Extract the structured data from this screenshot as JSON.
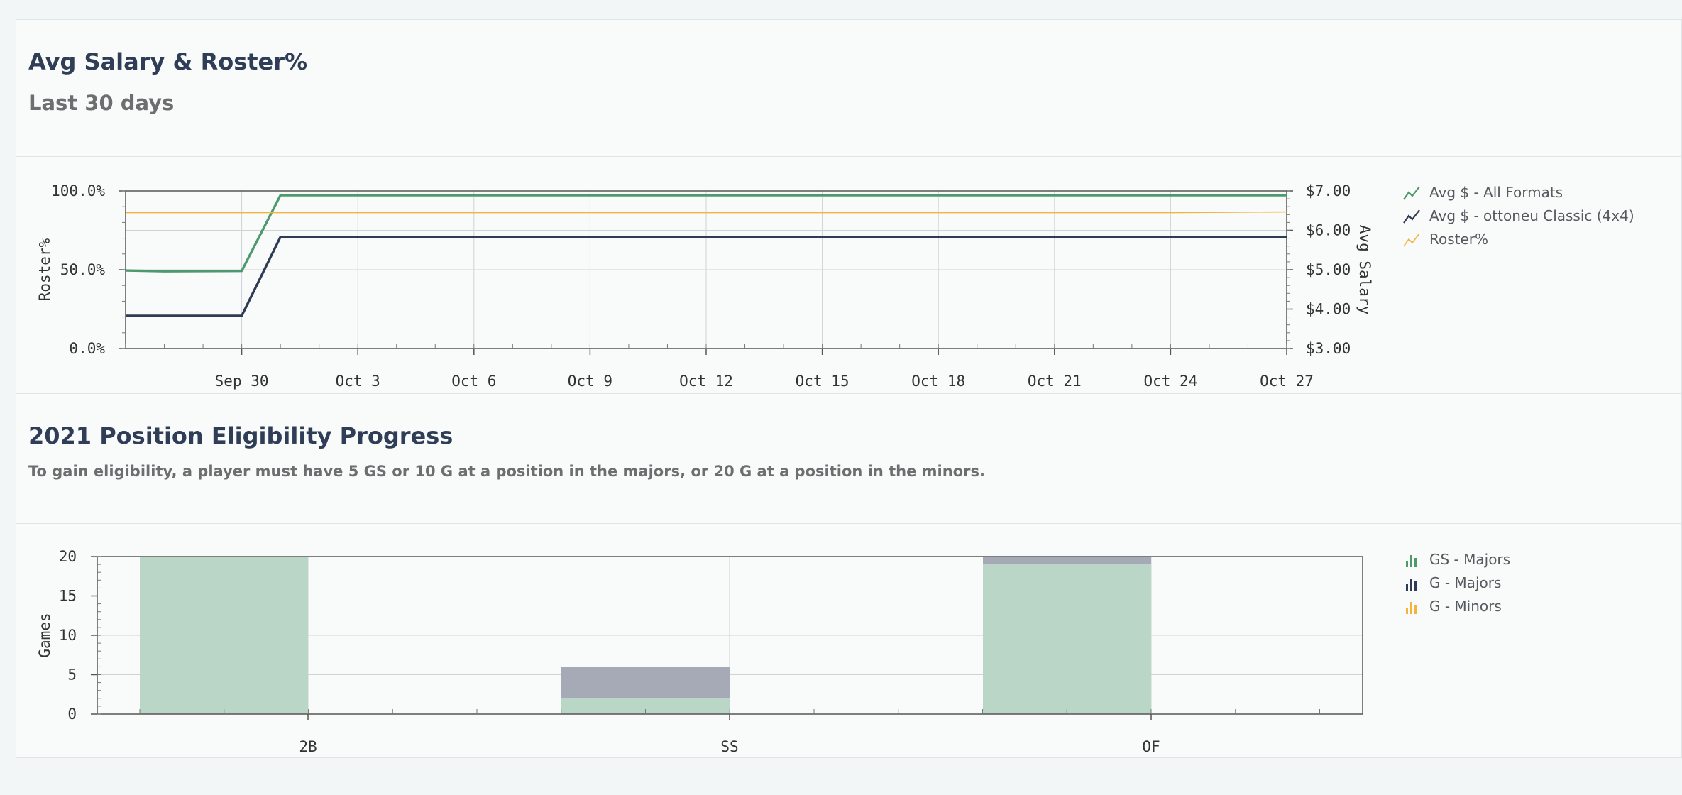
{
  "section1": {
    "title": "Avg Salary & Roster%",
    "subtitle": "Last 30 days"
  },
  "section2": {
    "title": "2021 Position Eligibility Progress",
    "subtitle": "To gain eligibility, a player must have 5 GS or 10 G at a position in the majors, or 20 G at a position in the minors."
  },
  "legend1": [
    {
      "label": "Avg $ - All Formats",
      "color": "#4e9a6e",
      "icon": "line-chart-icon"
    },
    {
      "label": "Avg $ - ottoneu Classic (4x4)",
      "color": "#2f3a55",
      "icon": "line-chart-icon"
    },
    {
      "label": "Roster%",
      "color": "#f3b33d",
      "icon": "line-chart-icon"
    }
  ],
  "legend2": [
    {
      "label": "GS - Majors",
      "color": "#4e9a6e",
      "icon": "bar-chart-icon"
    },
    {
      "label": "G - Majors",
      "color": "#2f3a55",
      "icon": "bar-chart-icon"
    },
    {
      "label": "G - Minors",
      "color": "#f3b33d",
      "icon": "bar-chart-icon"
    }
  ],
  "chart_data": [
    {
      "type": "line",
      "x_tick_labels": [
        "Sep 30",
        "Oct 3",
        "Oct 6",
        "Oct 9",
        "Oct 12",
        "Oct 15",
        "Oct 18",
        "Oct 21",
        "Oct 24",
        "Oct 27"
      ],
      "x_range": [
        "Sep 27",
        "Oct 27"
      ],
      "ylabel": "Roster%",
      "ylim": [
        0,
        100
      ],
      "y_ticks": [
        0,
        50,
        100
      ],
      "y_tick_labels": [
        "0.0%",
        "50.0%",
        "100.0%"
      ],
      "y2label": "Avg Salary",
      "y2lim": [
        3,
        7
      ],
      "y2_ticks": [
        3,
        4,
        5,
        6,
        7
      ],
      "y2_tick_labels": [
        "$3.00",
        "$4.00",
        "$5.00",
        "$6.00",
        "$7.00"
      ],
      "grid": true,
      "legend": "right",
      "series": [
        {
          "name": "Avg $ - All Formats",
          "axis": "right",
          "color": "#4e9a6e",
          "x": [
            "Sep 27",
            "Sep 28",
            "Sep 30",
            "Oct 1",
            "Oct 27"
          ],
          "values": [
            4.98,
            4.96,
            4.97,
            6.89,
            6.89
          ]
        },
        {
          "name": "Avg $ - ottoneu Classic (4x4)",
          "axis": "right",
          "color": "#2f3a55",
          "x": [
            "Sep 27",
            "Sep 30",
            "Oct 1",
            "Oct 27"
          ],
          "values": [
            3.83,
            3.83,
            5.83,
            5.83
          ]
        },
        {
          "name": "Roster%",
          "axis": "left",
          "color": "#f3b33d",
          "x": [
            "Sep 27",
            "Oct 24",
            "Oct 27"
          ],
          "values": [
            86.2,
            86.2,
            86.7
          ]
        }
      ]
    },
    {
      "type": "bar",
      "stacked": true,
      "categories": [
        "2B",
        "SS",
        "OF"
      ],
      "ylabel": "Games",
      "ylim": [
        0,
        20
      ],
      "y_ticks": [
        0,
        5,
        10,
        15,
        20
      ],
      "grid": true,
      "legend": "right",
      "series": [
        {
          "name": "GS - Majors",
          "color": "#bad6c7",
          "values": [
            20,
            2,
            19
          ]
        },
        {
          "name": "G - Majors",
          "color": "#a6aab6",
          "values": [
            0,
            4,
            1
          ]
        },
        {
          "name": "G - Minors",
          "color": "#f3b33d",
          "values": [
            0,
            0,
            0
          ]
        }
      ]
    }
  ]
}
